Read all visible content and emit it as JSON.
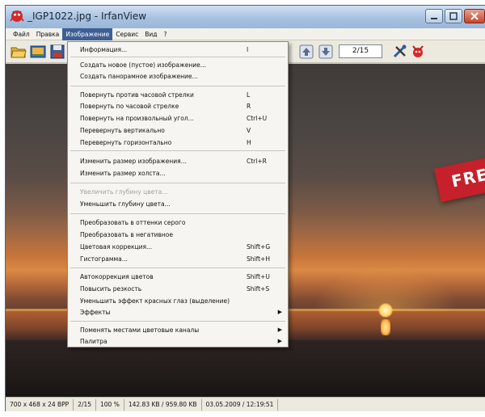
{
  "window": {
    "title": "_IGP1022.jpg - IrfanView"
  },
  "menubar": {
    "items": [
      "Файл",
      "Правка",
      "Изображение",
      "Сервис",
      "Вид",
      "?"
    ]
  },
  "toolbar": {
    "page_indicator": "2/15",
    "icons": [
      "open-folder-icon",
      "slideshow-icon",
      "save-icon",
      "prev-file-icon",
      "next-file-icon",
      "properties-icon",
      "exit-icon"
    ]
  },
  "image_menu": {
    "items": [
      {
        "label": "Информация...",
        "shortcut": "I"
      },
      {
        "label": "Создать новое (пустое) изображение...",
        "shortcut": ""
      },
      {
        "label": "Создать панорамное изображение...",
        "shortcut": ""
      },
      {
        "label": "Повернуть против часовой стрелки",
        "shortcut": "L"
      },
      {
        "label": "Повернуть по часовой стрелке",
        "shortcut": "R"
      },
      {
        "label": "Повернуть на произвольный угол...",
        "shortcut": "Ctrl+U"
      },
      {
        "label": "Перевернуть вертикально",
        "shortcut": "V"
      },
      {
        "label": "Перевернуть горизонтально",
        "shortcut": "H"
      },
      {
        "label": "Изменить размер изображения...",
        "shortcut": "Ctrl+R"
      },
      {
        "label": "Изменить размер холста...",
        "shortcut": ""
      },
      {
        "label": "Увеличить глубину цвета...",
        "shortcut": "",
        "disabled": true
      },
      {
        "label": "Уменьшить глубину цвета...",
        "shortcut": ""
      },
      {
        "label": "Преобразовать в оттенки серого",
        "shortcut": ""
      },
      {
        "label": "Преобразовать в негативное",
        "shortcut": ""
      },
      {
        "label": "Цветовая коррекция...",
        "shortcut": "Shift+G"
      },
      {
        "label": "Гистограмма...",
        "shortcut": "Shift+H"
      },
      {
        "label": "Автокоррекция цветов",
        "shortcut": "Shift+U"
      },
      {
        "label": "Повысить резкость",
        "shortcut": "Shift+S"
      },
      {
        "label": "Уменьшить эффект красных глаз (выделение)",
        "shortcut": ""
      },
      {
        "label": "Эффекты",
        "shortcut": "",
        "submenu": true
      },
      {
        "label": "Поменять местами цветовые каналы",
        "shortcut": "",
        "submenu": true
      },
      {
        "label": "Палитра",
        "shortcut": "",
        "submenu": true
      }
    ]
  },
  "image_overlay": {
    "banner_text": "FRE",
    "banner_color": "#c6202b"
  },
  "statusbar": {
    "dimensions": "700 x 468 x 24 BPP",
    "file_index": "2/15",
    "zoom": "100 %",
    "file_size": "142.83 KB / 959.80 KB",
    "datetime": "03.05.2009 / 12:19:51"
  },
  "colors": {
    "menu_highlight": "#3d5f94",
    "title_bar": "#a7c1e0",
    "close_button": "#c7452c"
  }
}
